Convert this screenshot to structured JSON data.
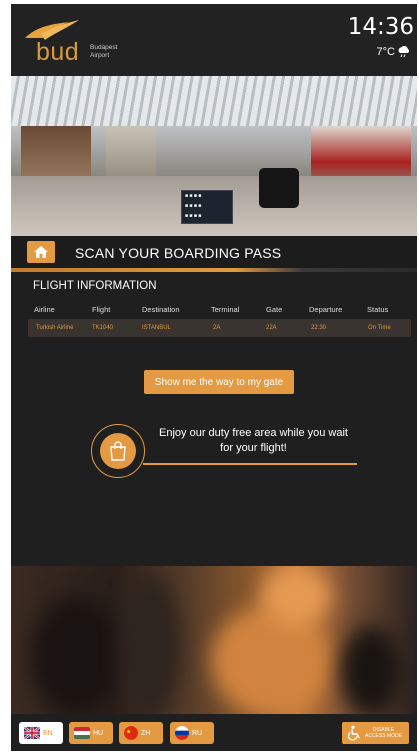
{
  "header": {
    "logo_text": "bud",
    "logo_sub_line1": "Budapest",
    "logo_sub_line2": "Airport",
    "time": "14:36",
    "temperature": "7°C",
    "weather_icon": "cloud-rain-icon"
  },
  "scan": {
    "title": "SCAN YOUR BOARDING PASS",
    "home_icon": "home-icon"
  },
  "flight_info": {
    "title": "FLIGHT INFORMATION",
    "columns": [
      "Airline",
      "Flight",
      "Destination",
      "Terminal",
      "Gate",
      "Departure",
      "Status"
    ],
    "row": [
      "Turkish Airline",
      "TK1040",
      "ISTANBUL",
      "2A",
      "22A",
      "22:30",
      "On Time"
    ]
  },
  "gate_button": {
    "label": "Show me the way to my gate"
  },
  "duty_free": {
    "line1": "Enjoy our duty free area while you wait",
    "line2": "for your flight!",
    "icon": "shopping-bag-icon"
  },
  "languages": [
    {
      "code": "EN",
      "selected": true
    },
    {
      "code": "HU",
      "selected": false
    },
    {
      "code": "ZH",
      "selected": false
    },
    {
      "code": "RU",
      "selected": false
    }
  ],
  "access": {
    "line1": "DISABLE",
    "line2": "ACCESS MODE",
    "icon": "wheelchair-icon"
  },
  "colors": {
    "accent": "#e39a42",
    "background": "#1f1f1f",
    "selected_lang": "#ffffff"
  }
}
